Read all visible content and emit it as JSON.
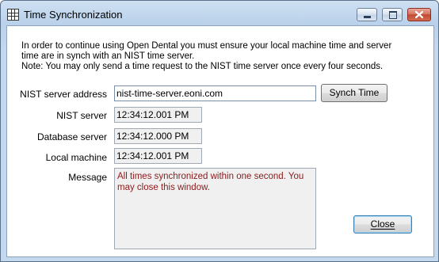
{
  "window": {
    "title": "Time Synchronization",
    "controls": [
      "minimize-icon",
      "maximize-icon",
      "close-icon"
    ]
  },
  "intro": {
    "line1": "In order to continue using Open Dental you must ensure your local machine time and server",
    "line2": "time are in synch with an NIST time server.",
    "line3": "Note: You may only send a time request to the NIST time server once every four seconds."
  },
  "form": {
    "nist_address_label": "NIST server address",
    "nist_address_value": "nist-time-server.eoni.com",
    "sync_button": "Synch Time",
    "nist_server_label": "NIST server",
    "nist_server_value": "12:34:12.001 PM",
    "database_server_label": "Database server",
    "database_server_value": "12:34:12.000 PM",
    "local_machine_label": "Local machine",
    "local_machine_value": "12:34:12.001 PM",
    "message_label": "Message",
    "message_value": "All times synchronized within one second.  You may close this window."
  },
  "footer": {
    "close_button": "Close"
  },
  "colors": {
    "message_text": "#8b1a1a",
    "close_accent": "#3c7fb1"
  }
}
